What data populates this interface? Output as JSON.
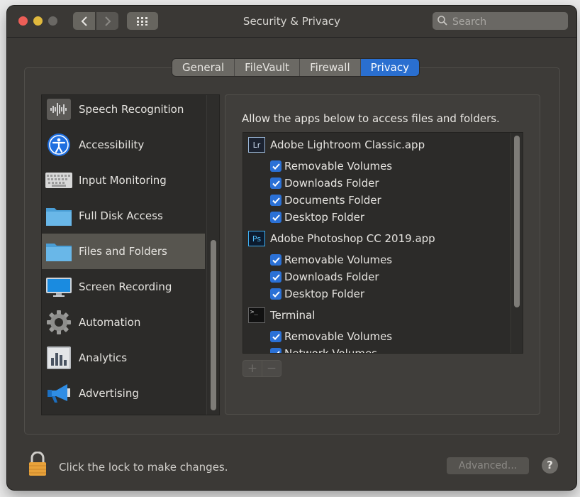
{
  "window": {
    "title": "Security & Privacy",
    "search_placeholder": "Search"
  },
  "tabs": [
    {
      "label": "General",
      "active": false
    },
    {
      "label": "FileVault",
      "active": false
    },
    {
      "label": "Firewall",
      "active": false
    },
    {
      "label": "Privacy",
      "active": true
    }
  ],
  "sidebar": {
    "items": [
      {
        "label": "Speech Recognition",
        "icon": "speech-waveform-icon",
        "selected": false
      },
      {
        "label": "Accessibility",
        "icon": "accessibility-icon",
        "selected": false
      },
      {
        "label": "Input Monitoring",
        "icon": "keyboard-icon",
        "selected": false
      },
      {
        "label": "Full Disk Access",
        "icon": "folder-icon",
        "selected": false
      },
      {
        "label": "Files and Folders",
        "icon": "folder-icon",
        "selected": true
      },
      {
        "label": "Screen Recording",
        "icon": "display-icon",
        "selected": false
      },
      {
        "label": "Automation",
        "icon": "gear-icon",
        "selected": false
      },
      {
        "label": "Analytics",
        "icon": "bar-chart-icon",
        "selected": false
      },
      {
        "label": "Advertising",
        "icon": "megaphone-icon",
        "selected": false
      }
    ]
  },
  "main": {
    "intro": "Allow the apps below to access files and folders.",
    "apps": [
      {
        "name": "Adobe Lightroom Classic.app",
        "icon_text": "Lr",
        "icon": "lightroom-icon",
        "permissions": [
          "Removable Volumes",
          "Downloads Folder",
          "Documents Folder",
          "Desktop Folder"
        ]
      },
      {
        "name": "Adobe Photoshop CC 2019.app",
        "icon_text": "Ps",
        "icon": "photoshop-icon",
        "permissions": [
          "Removable Volumes",
          "Downloads Folder",
          "Desktop Folder"
        ]
      },
      {
        "name": "Terminal",
        "icon_text": ">_",
        "icon": "terminal-icon",
        "permissions": [
          "Removable Volumes",
          "Network Volumes"
        ]
      }
    ],
    "add_label": "+",
    "remove_label": "−"
  },
  "footer": {
    "lock_text": "Click the lock to make changes.",
    "advanced_label": "Advanced...",
    "help_label": "?"
  },
  "colors": {
    "accent": "#2a6fd0",
    "window_bg": "#3b3936",
    "list_bg": "#2c2b29"
  }
}
